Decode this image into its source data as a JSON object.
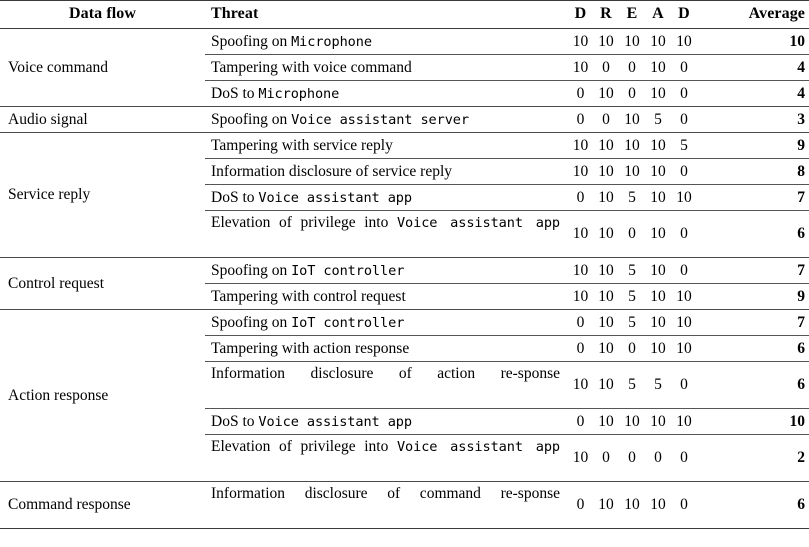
{
  "table": {
    "headers": {
      "data_flow": "Data flow",
      "threat": "Threat",
      "d1": "D",
      "r": "R",
      "e": "E",
      "a": "A",
      "d2": "D",
      "average": "Average"
    },
    "groups": [
      {
        "data_flow": "Voice command",
        "rows": [
          {
            "threat_parts": [
              {
                "text": "Spoofing on ",
                "style": "serif"
              },
              {
                "text": "Microphone",
                "style": "mono"
              }
            ],
            "threat_plain": "Spoofing on Microphone",
            "d1": "10",
            "r": "10",
            "e": "10",
            "a": "10",
            "d2": "10",
            "average": "10"
          },
          {
            "threat_parts": [
              {
                "text": "Tampering with voice command",
                "style": "serif"
              }
            ],
            "threat_plain": "Tampering with voice command",
            "d1": "10",
            "r": "0",
            "e": "0",
            "a": "10",
            "d2": "0",
            "average": "4"
          },
          {
            "threat_parts": [
              {
                "text": "DoS to ",
                "style": "serif"
              },
              {
                "text": "Microphone",
                "style": "mono"
              }
            ],
            "threat_plain": "DoS to Microphone",
            "d1": "0",
            "r": "10",
            "e": "0",
            "a": "10",
            "d2": "0",
            "average": "4"
          }
        ]
      },
      {
        "data_flow": "Audio signal",
        "rows": [
          {
            "threat_parts": [
              {
                "text": "Spoofing on ",
                "style": "serif"
              },
              {
                "text": "Voice assistant server",
                "style": "mono"
              }
            ],
            "threat_plain": "Spoofing on Voice assistant server",
            "d1": "0",
            "r": "0",
            "e": "10",
            "a": "5",
            "d2": "0",
            "average": "3"
          }
        ]
      },
      {
        "data_flow": "Service reply",
        "rows": [
          {
            "threat_parts": [
              {
                "text": "Tampering with service reply",
                "style": "serif"
              }
            ],
            "threat_plain": "Tampering with service reply",
            "d1": "10",
            "r": "10",
            "e": "10",
            "a": "10",
            "d2": "5",
            "average": "9"
          },
          {
            "threat_parts": [
              {
                "text": "Information disclosure of service reply",
                "style": "serif"
              }
            ],
            "threat_plain": "Information disclosure of service reply",
            "d1": "10",
            "r": "10",
            "e": "10",
            "a": "10",
            "d2": "0",
            "average": "8"
          },
          {
            "threat_parts": [
              {
                "text": "DoS to ",
                "style": "serif"
              },
              {
                "text": "Voice assistant app",
                "style": "mono"
              }
            ],
            "threat_plain": "DoS to Voice assistant app",
            "d1": "0",
            "r": "10",
            "e": "5",
            "a": "10",
            "d2": "10",
            "average": "7"
          },
          {
            "threat_parts": [
              {
                "text": "Elevation of privilege into ",
                "style": "serif"
              },
              {
                "text": "Voice assistant app",
                "style": "mono"
              }
            ],
            "threat_plain": "Elevation of privilege into Voice assistant app",
            "two_line": true,
            "d1": "10",
            "r": "10",
            "e": "0",
            "a": "10",
            "d2": "0",
            "average": "6"
          }
        ]
      },
      {
        "data_flow": "Control request",
        "rows": [
          {
            "threat_parts": [
              {
                "text": "Spoofing on ",
                "style": "serif"
              },
              {
                "text": "IoT controller",
                "style": "mono"
              }
            ],
            "threat_plain": "Spoofing on IoT controller",
            "d1": "10",
            "r": "10",
            "e": "5",
            "a": "10",
            "d2": "0",
            "average": "7"
          },
          {
            "threat_parts": [
              {
                "text": "Tampering with control request",
                "style": "serif"
              }
            ],
            "threat_plain": "Tampering with control request",
            "d1": "10",
            "r": "10",
            "e": "5",
            "a": "10",
            "d2": "10",
            "average": "9"
          }
        ]
      },
      {
        "data_flow": "Action response",
        "rows": [
          {
            "threat_parts": [
              {
                "text": "Spoofing on ",
                "style": "serif"
              },
              {
                "text": "IoT controller",
                "style": "mono"
              }
            ],
            "threat_plain": "Spoofing on IoT controller",
            "d1": "0",
            "r": "10",
            "e": "5",
            "a": "10",
            "d2": "10",
            "average": "7"
          },
          {
            "threat_parts": [
              {
                "text": "Tampering with action response",
                "style": "serif"
              }
            ],
            "threat_plain": "Tampering with action response",
            "d1": "0",
            "r": "10",
            "e": "0",
            "a": "10",
            "d2": "10",
            "average": "6"
          },
          {
            "threat_parts": [
              {
                "text": "Information disclosure of action re-sponse",
                "style": "serif"
              }
            ],
            "threat_plain": "Information disclosure of action re-sponse",
            "two_line": true,
            "d1": "10",
            "r": "10",
            "e": "5",
            "a": "5",
            "d2": "0",
            "average": "6"
          },
          {
            "threat_parts": [
              {
                "text": "DoS to ",
                "style": "serif"
              },
              {
                "text": "Voice assistant app",
                "style": "mono"
              }
            ],
            "threat_plain": "DoS to Voice assistant app",
            "d1": "0",
            "r": "10",
            "e": "10",
            "a": "10",
            "d2": "10",
            "average": "10"
          },
          {
            "threat_parts": [
              {
                "text": "Elevation of privilege into ",
                "style": "serif"
              },
              {
                "text": "Voice assistant app",
                "style": "mono"
              }
            ],
            "threat_plain": "Elevation of privilege into Voice assistant app",
            "two_line": true,
            "d1": "10",
            "r": "0",
            "e": "0",
            "a": "0",
            "d2": "0",
            "average": "2"
          }
        ]
      },
      {
        "data_flow": "Command response",
        "rows": [
          {
            "threat_parts": [
              {
                "text": "Information disclosure of command re-sponse",
                "style": "serif"
              }
            ],
            "threat_plain": "Information disclosure of command re-sponse",
            "two_line": true,
            "d1": "0",
            "r": "10",
            "e": "10",
            "a": "10",
            "d2": "0",
            "average": "6"
          }
        ]
      }
    ]
  }
}
